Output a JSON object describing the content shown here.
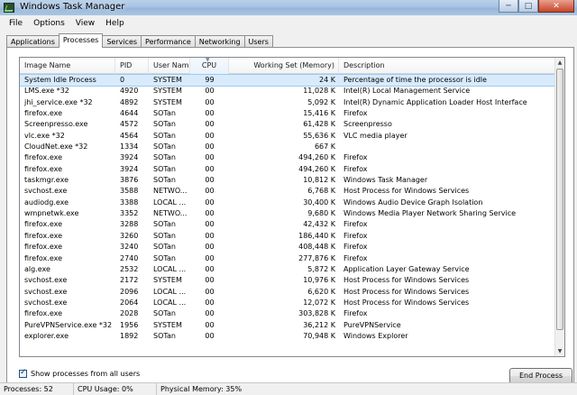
{
  "window": {
    "title": "Windows Task Manager"
  },
  "menu": [
    "File",
    "Options",
    "View",
    "Help"
  ],
  "tabs": [
    {
      "label": "Applications",
      "active": false
    },
    {
      "label": "Processes",
      "active": true
    },
    {
      "label": "Services",
      "active": false
    },
    {
      "label": "Performance",
      "active": false
    },
    {
      "label": "Networking",
      "active": false
    },
    {
      "label": "Users",
      "active": false
    }
  ],
  "columns": [
    "Image Name",
    "PID",
    "User Name",
    "CPU",
    "Working Set (Memory)",
    "Description"
  ],
  "sorted_column": "CPU",
  "processes": [
    [
      "System Idle Process",
      "0",
      "SYSTEM",
      "99",
      "24 K",
      "Percentage of time the processor is idle"
    ],
    [
      "LMS.exe *32",
      "4920",
      "SYSTEM",
      "00",
      "11,028 K",
      "Intel(R) Local Management Service"
    ],
    [
      "jhi_service.exe *32",
      "4892",
      "SYSTEM",
      "00",
      "5,092 K",
      "Intel(R) Dynamic Application Loader Host Interface"
    ],
    [
      "firefox.exe",
      "4644",
      "SOTan",
      "00",
      "15,416 K",
      "Firefox"
    ],
    [
      "Screenpresso.exe",
      "4572",
      "SOTan",
      "00",
      "61,428 K",
      "Screenpresso"
    ],
    [
      "vlc.exe *32",
      "4564",
      "SOTan",
      "00",
      "55,636 K",
      "VLC media player"
    ],
    [
      "CloudNet.exe *32",
      "1334",
      "SOTan",
      "00",
      "667 K",
      ""
    ],
    [
      "firefox.exe",
      "3924",
      "SOTan",
      "00",
      "494,260 K",
      "Firefox"
    ],
    [
      "firefox.exe",
      "3924",
      "SOTan",
      "00",
      "494,260 K",
      "Firefox"
    ],
    [
      "taskmgr.exe",
      "3876",
      "SOTan",
      "00",
      "10,812 K",
      "Windows Task Manager"
    ],
    [
      "svchost.exe",
      "3588",
      "NETWO...",
      "00",
      "6,768 K",
      "Host Process for Windows Services"
    ],
    [
      "audiodg.exe",
      "3388",
      "LOCAL ...",
      "00",
      "30,400 K",
      "Windows Audio Device Graph Isolation"
    ],
    [
      "wmpnetwk.exe",
      "3352",
      "NETWO...",
      "00",
      "9,680 K",
      "Windows Media Player Network Sharing Service"
    ],
    [
      "firefox.exe",
      "3288",
      "SOTan",
      "00",
      "42,432 K",
      "Firefox"
    ],
    [
      "firefox.exe",
      "3260",
      "SOTan",
      "00",
      "186,440 K",
      "Firefox"
    ],
    [
      "firefox.exe",
      "3240",
      "SOTan",
      "00",
      "408,448 K",
      "Firefox"
    ],
    [
      "firefox.exe",
      "2740",
      "SOTan",
      "00",
      "277,876 K",
      "Firefox"
    ],
    [
      "alg.exe",
      "2532",
      "LOCAL ...",
      "00",
      "5,872 K",
      "Application Layer Gateway Service"
    ],
    [
      "svchost.exe",
      "2172",
      "SYSTEM",
      "00",
      "10,976 K",
      "Host Process for Windows Services"
    ],
    [
      "svchost.exe",
      "2096",
      "LOCAL ...",
      "00",
      "6,620 K",
      "Host Process for Windows Services"
    ],
    [
      "svchost.exe",
      "2064",
      "LOCAL ...",
      "00",
      "12,072 K",
      "Host Process for Windows Services"
    ],
    [
      "firefox.exe",
      "2028",
      "SOTan",
      "00",
      "303,828 K",
      "Firefox"
    ],
    [
      "PureVPNService.exe *32",
      "1956",
      "SYSTEM",
      "00",
      "36,212 K",
      "PureVPNService"
    ],
    [
      "explorer.exe",
      "1892",
      "SOTan",
      "00",
      "70,948 K",
      "Windows Explorer"
    ]
  ],
  "show_all_users": {
    "label": "Show processes from all users",
    "checked": true
  },
  "end_process_label": "End Process",
  "status": {
    "processes": "Processes: 52",
    "cpu": "CPU Usage: 0%",
    "memory": "Physical Memory: 35%"
  }
}
